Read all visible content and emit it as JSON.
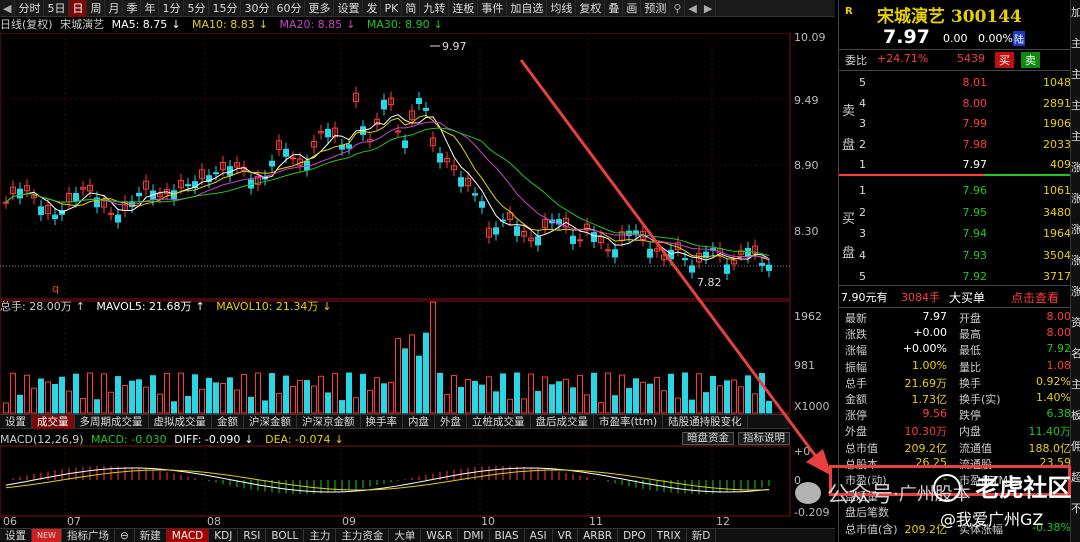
{
  "toolbar": {
    "items": [
      "分时",
      "5日",
      "日",
      "周",
      "月",
      "季",
      "年",
      "1分",
      "5分",
      "15分",
      "30分",
      "60分",
      "更多",
      "设置",
      "发",
      "PK",
      "简",
      "九转",
      "连板",
      "事件",
      "加自选",
      "均线",
      "复权",
      "叠",
      "画",
      "预测"
    ],
    "selected": "日"
  },
  "info": {
    "period": "日线(复权)",
    "name": "宋城演艺",
    "ma5": "MA5: 8.75",
    "ma10": "MA10: 8.83",
    "ma20": "MA20: 8.85",
    "ma30": "MA30: 8.90",
    "ma5_arrow": "↓",
    "ma10_arrow": "↓",
    "ma20_arrow": "↓",
    "ma30_arrow": "↓"
  },
  "price_axis": [
    "10.09",
    "9.49",
    "8.90",
    "8.30"
  ],
  "price_marks": {
    "high": "9.97",
    "low": "7.82",
    "flag": "q"
  },
  "volume": {
    "total": "总手: 28.00万",
    "mavol5": "MAVOL5: 21.68万",
    "mavol10": "MAVOL10: 21.34万",
    "total_arrow": "↑",
    "mavol5_arrow": "↑",
    "mavol10_arrow": "↓",
    "axis": [
      "1962",
      "981",
      "X1000"
    ]
  },
  "mid_tabs": [
    "设置",
    "成交量",
    "多周期成交量",
    "虚拟成交量",
    "金额",
    "沪深金额",
    "沪深京金额",
    "换手率",
    "内盘",
    "外盘",
    "立桩成交量",
    "盘后成交量",
    "市盈率(ttm)",
    "陆股通持股变化"
  ],
  "mid_selected": "成交量",
  "mid_buttons": [
    "暗盘资金",
    "指标说明"
  ],
  "macd": {
    "title": "MACD(12,26,9)",
    "macd": "MACD: -0.030",
    "diff": "DIFF: -0.090",
    "dea": "DEA: -0.074",
    "diff_arrow": "↓",
    "dea_arrow": "↓",
    "axis": [
      "+0",
      "0",
      "-0.209"
    ]
  },
  "dates": [
    "06",
    "07",
    "08",
    "09",
    "10",
    "11",
    "12"
  ],
  "bottom_tabs": [
    "设置",
    "NEW",
    "指标广场",
    "⊖",
    "新建",
    "MACD",
    "KDJ",
    "RSI",
    "BOLL",
    "主力",
    "主力资金",
    "大单",
    "W&R",
    "DMI",
    "BIAS",
    "ASI",
    "VR",
    "ARBR",
    "DPO",
    "TRIX",
    "新D"
  ],
  "bottom_selected": "MACD",
  "stock": {
    "code_badge": "R",
    "title": "宋城演艺 300144",
    "price": "7.97",
    "change": "0.00",
    "change_pct": "0.00%",
    "exchange_badge": "陆",
    "ratio_label": "委比",
    "ratio": "+24.71%",
    "diff_qty": "5439",
    "buy_btn": "买",
    "sell_btn": "卖"
  },
  "sell_label": [
    "卖",
    "盘"
  ],
  "buy_label": [
    "买",
    "盘"
  ],
  "asks": [
    {
      "n": "5",
      "p": "8.01",
      "v": "1048"
    },
    {
      "n": "4",
      "p": "8.00",
      "v": "2891"
    },
    {
      "n": "3",
      "p": "7.99",
      "v": "1906"
    },
    {
      "n": "2",
      "p": "7.98",
      "v": "2033"
    },
    {
      "n": "1",
      "p": "7.97",
      "v": "409"
    }
  ],
  "bids": [
    {
      "n": "1",
      "p": "7.96",
      "v": "1061"
    },
    {
      "n": "2",
      "p": "7.95",
      "v": "3480"
    },
    {
      "n": "3",
      "p": "7.94",
      "v": "1964"
    },
    {
      "n": "4",
      "p": "7.93",
      "v": "3504"
    },
    {
      "n": "5",
      "p": "7.92",
      "v": "3717"
    }
  ],
  "big": {
    "price": "7.90元有",
    "qty": "3084手",
    "label": "大买单",
    "link": "点击查看"
  },
  "stats": [
    {
      "l": "最新",
      "v": "7.97",
      "l2": "开盘",
      "v2": "8.00",
      "c": "white",
      "c2": "red"
    },
    {
      "l": "涨跌",
      "v": "+0.00",
      "l2": "最高",
      "v2": "8.00",
      "c": "white",
      "c2": "red"
    },
    {
      "l": "涨幅",
      "v": "+0.00%",
      "l2": "最低",
      "v2": "7.92",
      "c": "white",
      "c2": "green"
    },
    {
      "l": "振幅",
      "v": "1.00%",
      "l2": "量比",
      "v2": "1.08",
      "c": "yellow",
      "c2": "red"
    },
    {
      "l": "总手",
      "v": "21.69万",
      "l2": "换手",
      "v2": "0.92%",
      "c": "yellow",
      "c2": "yellow"
    },
    {
      "l": "金额",
      "v": "1.73亿",
      "l2": "换手(实)",
      "v2": "1.40%",
      "c": "yellow",
      "c2": "yellow"
    },
    {
      "l": "涨停",
      "v": "9.56",
      "l2": "跌停",
      "v2": "6.38",
      "c": "red",
      "c2": "green"
    },
    {
      "l": "外盘",
      "v": "10.30万",
      "l2": "内盘",
      "v2": "11.40万",
      "c": "red",
      "c2": "green"
    },
    {
      "l": "总市值",
      "v": "209.2亿",
      "l2": "流通值",
      "v2": "188.0亿",
      "c": "yellow",
      "c2": "yellow"
    },
    {
      "l": "总股本",
      "v": "26.25",
      "l2": "流通股",
      "v2": "23.59",
      "c": "yellow",
      "c2": "yellow"
    },
    {
      "l": "市盈(动)",
      "v": "-",
      "l2": "市盈(TTM)",
      "v2": "-",
      "c": "yellow",
      "c2": "yellow"
    },
    {
      "l": "盘后量",
      "v": "",
      "l2": "",
      "v2": "",
      "c": "yellow",
      "c2": "yellow"
    },
    {
      "l": "盘后笔数",
      "v": "",
      "l2": "",
      "v2": "",
      "c": "yellow",
      "c2": "yellow"
    },
    {
      "l": "总市值(含)",
      "v": "209.2亿",
      "l2": "实体涨幅",
      "v2": "-0.38%",
      "c": "yellow",
      "c2": "green"
    }
  ],
  "farright_chars": [
    "加",
    "主",
    "主",
    "主",
    "主",
    "涨",
    "涨",
    "涨",
    "涨",
    "涨",
    "资",
    "名",
    "主",
    "板",
    "佣",
    "超",
    "不"
  ],
  "watermarks": {
    "left": "公众号",
    "left_tail": "·广州股本",
    "brand": "老虎社区",
    "handle": "@我爱广州GZ"
  },
  "colors": {
    "up": "#ff3a3a",
    "down": "#1ec81e",
    "ma5": "#ffffff",
    "ma10": "#e8d000",
    "ma20": "#d040d0",
    "ma30": "#1ec81e",
    "accent": "#e84040"
  }
}
